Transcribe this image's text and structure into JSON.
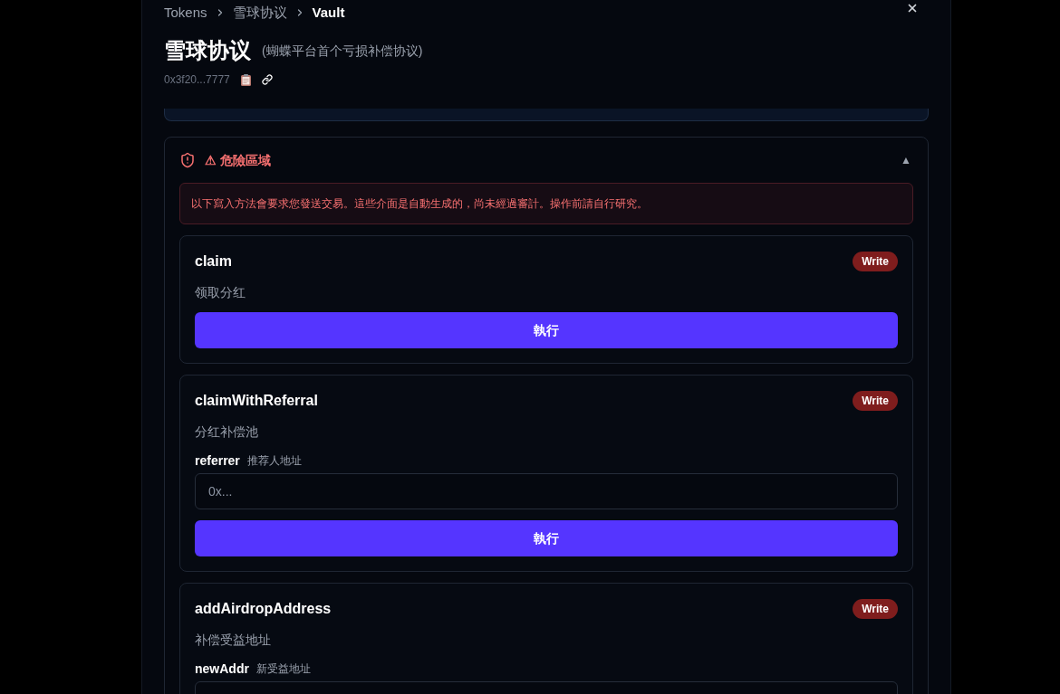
{
  "breadcrumb": [
    {
      "label": "Tokens",
      "current": false
    },
    {
      "label": "雪球协议",
      "current": false
    },
    {
      "label": "Vault",
      "current": true
    }
  ],
  "title": "雪球协议",
  "subtitle": "(蝴蝶平台首个亏损补偿协议)",
  "address": "0x3f20...7777",
  "danger_zone": {
    "title": "⚠ 危險區域",
    "expanded": true,
    "toggle": "▲",
    "warning": "以下寫入方法會要求您發送交易。這些介面是自動生成的，尚未經過審計。操作前請自行研究。",
    "methods": [
      {
        "name": "claim",
        "badge": "Write",
        "description": "领取分红",
        "button": "執行"
      },
      {
        "name": "claimWithReferral",
        "badge": "Write",
        "description": "分红补偿池",
        "params": [
          {
            "name": "referrer",
            "hint": "推荐人地址",
            "placeholder": "0x..."
          }
        ],
        "button": "執行"
      },
      {
        "name": "addAirdropAddress",
        "badge": "Write",
        "description": "补偿受益地址",
        "params": [
          {
            "name": "newAddr",
            "hint": "新受益地址"
          }
        ]
      }
    ]
  }
}
